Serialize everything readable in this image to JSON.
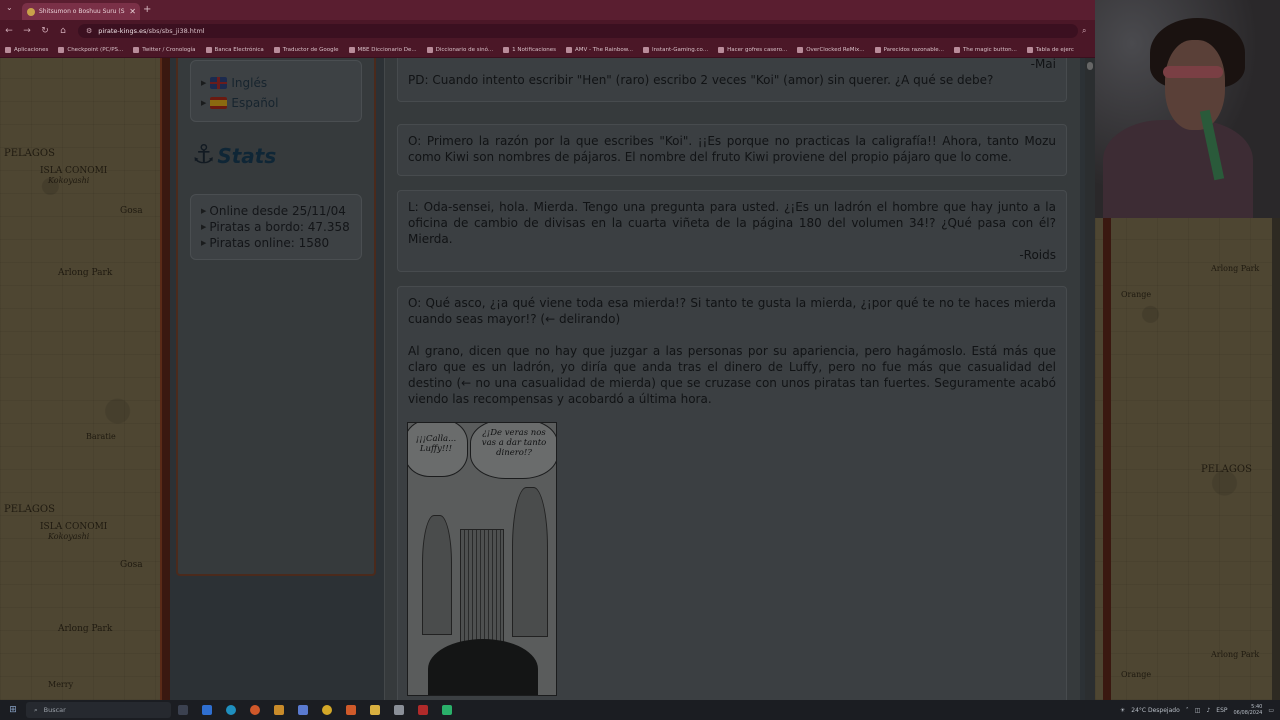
{
  "browser": {
    "tab_title": "Shitsumon o Boshuu Suru (SBS)",
    "url_domain": "pirate-kings.es",
    "url_path": "/sbs/sbs_ji38.html",
    "bookmarks": [
      "Aplicaciones",
      "Checkpoint (PC/PS...",
      "Twitter / Cronología",
      "Banca Electrónica",
      "Traductor de Google",
      "MBE Diccionario De...",
      "Diccionario de sinó...",
      "1 Notificaciones",
      "AMV - The Rainbow...",
      "Instant-Gaming.co...",
      "Hacer gofres casero...",
      "OverClocked ReMix...",
      "Parecidos razonable...",
      "The magic button...",
      "Tabla de ejerc"
    ]
  },
  "sidebar": {
    "languages": [
      "Inglés",
      "Español"
    ],
    "stats_title": "Stats",
    "stats": [
      "Online desde 25/11/04",
      "Piratas a bordo: 47.358",
      "Piratas online: 1580"
    ]
  },
  "content": {
    "top_sig": "-Mai",
    "qa": [
      {
        "prefix": "PD:",
        "text": "Cuando intento escribir \"Hen\" (raro) escribo 2 veces \"Koi\" (amor) sin querer. ¿A qué se debe?"
      },
      {
        "prefix": "O:",
        "text": "Primero la razón por la que escribes \"Koi\". ¡¡Es porque no practicas la caligrafía!! Ahora, tanto Mozu como Kiwi son nombres de pájaros. El nombre del fruto Kiwi proviene del propio pájaro que lo come."
      },
      {
        "prefix": "L:",
        "text": "Oda-sensei, hola. Mierda. Tengo una pregunta para usted. ¿¡Es un ladrón el hombre que hay junto a la oficina de cambio de divisas en la cuarta viñeta de la página 180 del volumen 34!? ¿Qué pasa con él? Mierda.",
        "signature": "-Roids"
      },
      {
        "prefix": "O:",
        "text": "Qué asco, ¿¡a qué viene toda esa mierda!? Si tanto te gusta la mierda, ¿¡por qué te no te haces mierda cuando seas mayor!? (← delirando)",
        "text2": "Al grano, dicen que no hay que juzgar a las personas por su apariencia, pero hagámoslo. Está más que claro que es un ladrón, yo diría que anda tras el dinero de Luffy, pero no fue más que casualidad del destino (← no una casualidad de mierda) que se cruzase con unos piratas tan fuertes. Seguramente acabó viendo las recompensas y acobardó a última hora."
      }
    ],
    "manga_bubbles": [
      "¡¡¡Calla... Luffy!!!",
      "¿¡De veras nos vas a dar tanto dinero!?"
    ]
  },
  "map_labels": [
    "PELAGOS",
    "ISLA CONOMI",
    "Kokoyashi",
    "Gosa",
    "Arlong Park",
    "Baratie",
    "Merry",
    "Orange"
  ],
  "taskbar": {
    "search_placeholder": "Buscar",
    "weather": "24°C Despejado",
    "lang": "ESP",
    "time": "5:40",
    "date": "06/08/2024"
  }
}
